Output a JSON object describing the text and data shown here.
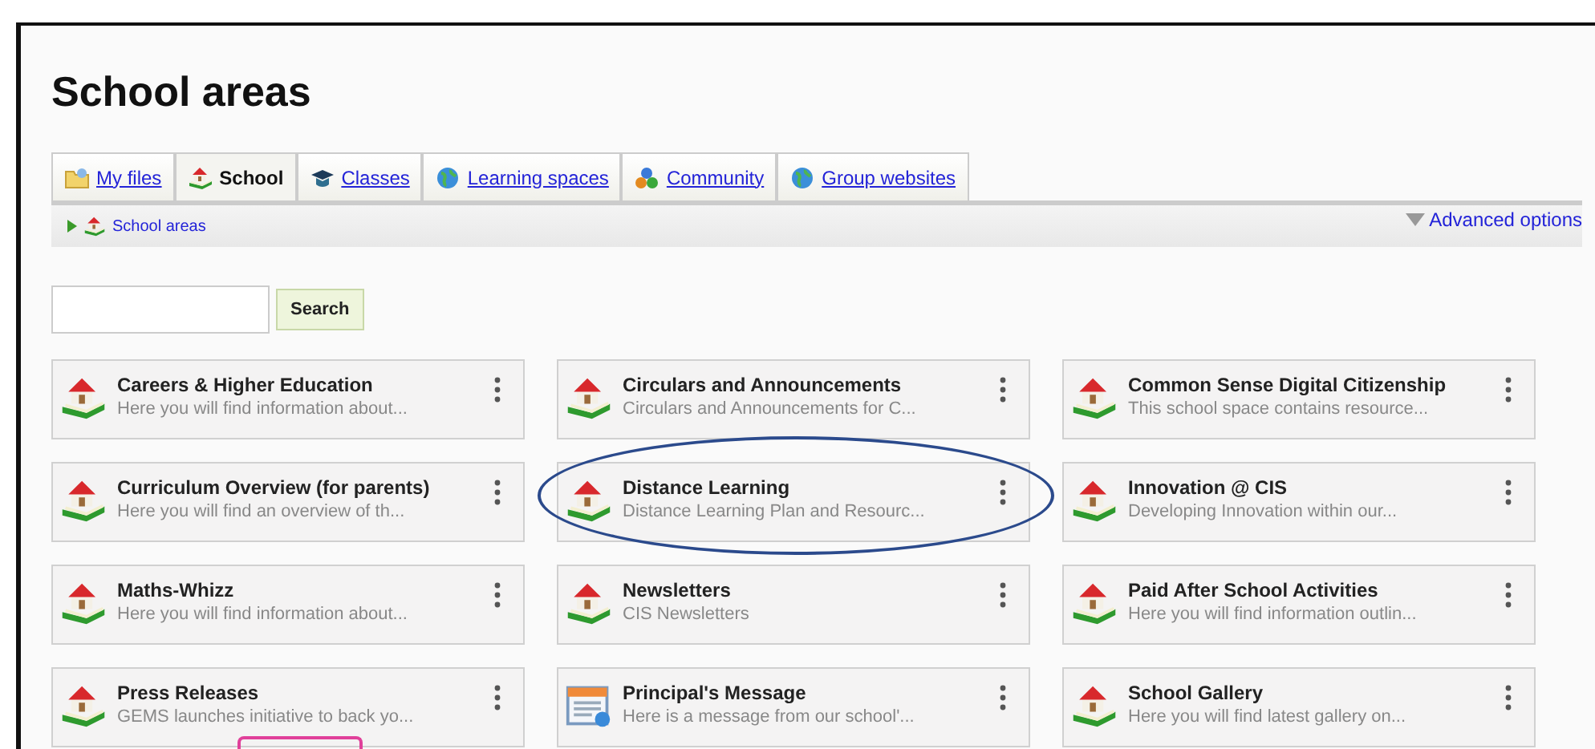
{
  "page": {
    "title": "School areas"
  },
  "tabs": [
    {
      "label": "My files",
      "selected": false
    },
    {
      "label": "School",
      "selected": true
    },
    {
      "label": "Classes",
      "selected": false
    },
    {
      "label": "Learning spaces",
      "selected": false
    },
    {
      "label": "Community",
      "selected": false
    },
    {
      "label": "Group websites",
      "selected": false
    }
  ],
  "breadcrumb": [
    {
      "label": "School areas"
    }
  ],
  "advanced_options": {
    "label": "Advanced options",
    "expanded": false
  },
  "search": {
    "button": "Search"
  },
  "areas": [
    {
      "title": "Careers & Higher Education",
      "description": "Here you will find information about...",
      "kind": "space",
      "highlighted": false,
      "badge": false
    },
    {
      "title": "Circulars and Announcements",
      "description": "Circulars and Announcements for C...",
      "kind": "space",
      "highlighted": false,
      "badge": false
    },
    {
      "title": "Common Sense Digital Citizenship",
      "description": "This school space contains resource...",
      "kind": "space",
      "highlighted": false,
      "badge": false
    },
    {
      "title": "Curriculum Overview (for parents)",
      "description": "Here you will find an overview of th...",
      "kind": "space",
      "highlighted": false,
      "badge": false
    },
    {
      "title": "Distance Learning",
      "description": "Distance Learning Plan and Resourc...",
      "kind": "space",
      "highlighted": true,
      "badge": false
    },
    {
      "title": "Innovation @ CIS",
      "description": "Developing Innovation within our...",
      "kind": "space",
      "highlighted": false,
      "badge": false
    },
    {
      "title": "Maths-Whizz",
      "description": "Here you will find information about...",
      "kind": "space",
      "highlighted": false,
      "badge": false
    },
    {
      "title": "Newsletters",
      "description": "CIS Newsletters",
      "kind": "space",
      "highlighted": false,
      "badge": false
    },
    {
      "title": "Paid After School Activities",
      "description": "Here you will find information outlin...",
      "kind": "space",
      "highlighted": false,
      "badge": false
    },
    {
      "title": "Press Releases",
      "description": "GEMS launches initiative to back yo...",
      "kind": "space",
      "highlighted": false,
      "badge": true
    },
    {
      "title": "Principal's Message",
      "description": "Here is a message from our school'...",
      "kind": "calendar",
      "highlighted": false,
      "badge": false
    },
    {
      "title": "School Gallery",
      "description": "Here you will find latest gallery on...",
      "kind": "space",
      "highlighted": false,
      "badge": false
    }
  ]
}
